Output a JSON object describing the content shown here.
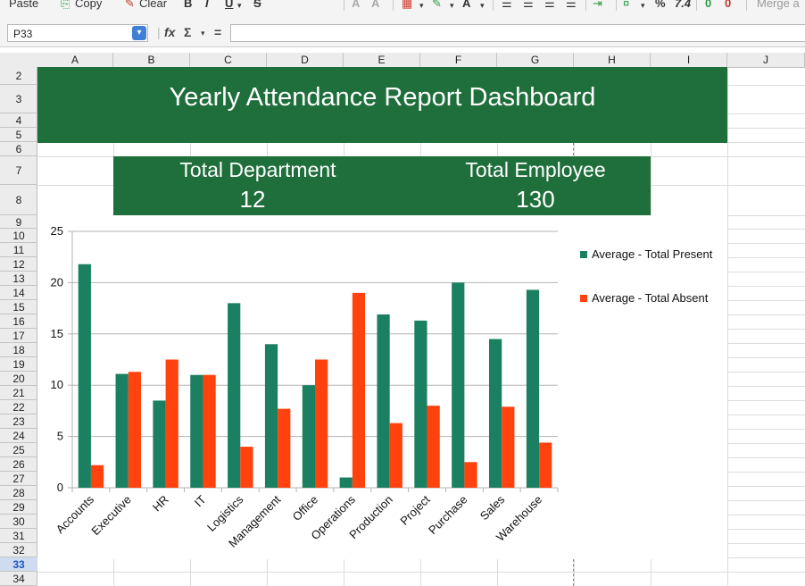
{
  "toolbar": {
    "paste": "Paste",
    "copy": "Copy",
    "clear": "Clear",
    "bold": "B",
    "italic": "I",
    "underline": "U",
    "strike": "S",
    "percent": "%",
    "decimal": "7.4",
    "merge": "Merge a"
  },
  "formula_bar": {
    "cell_ref": "P33",
    "fx": "fx",
    "sigma": "Σ",
    "equals": "=",
    "formula": ""
  },
  "columns": [
    "A",
    "B",
    "C",
    "D",
    "E",
    "F",
    "G",
    "H",
    "I",
    "J"
  ],
  "rows": [
    "2",
    "3",
    "4",
    "5",
    "6",
    "7",
    "8",
    "9",
    "10",
    "11",
    "12",
    "13",
    "14",
    "15",
    "16",
    "17",
    "18",
    "19",
    "20",
    "21",
    "22",
    "23",
    "24",
    "25",
    "26",
    "27",
    "28",
    "29",
    "30",
    "31",
    "32",
    "33",
    "34"
  ],
  "selected_row": "33",
  "dashboard": {
    "title": "Yearly Attendance Report Dashboard",
    "kpi_department_label": "Total Department",
    "kpi_department_value": "12",
    "kpi_employee_label": "Total Employee",
    "kpi_employee_value": "130"
  },
  "chart_data": {
    "type": "bar",
    "title": "",
    "xlabel": "",
    "ylabel": "",
    "ylim": [
      0,
      25
    ],
    "yticks": [
      0,
      5,
      10,
      15,
      20,
      25
    ],
    "grid": true,
    "legend_position": "right",
    "categories": [
      "Accounts",
      "Executive",
      "HR",
      "IT",
      "Logistics",
      "Management",
      "Office",
      "Operations",
      "Production",
      "Project",
      "Purchase",
      "Sales",
      "Warehouse"
    ],
    "series": [
      {
        "name": "Average - Total Present",
        "color": "#1b8061",
        "values": [
          21.8,
          11.1,
          8.5,
          11.0,
          18.0,
          14.0,
          10.0,
          1.0,
          16.9,
          16.3,
          20.0,
          14.5,
          19.3
        ]
      },
      {
        "name": "Average - Total Absent",
        "color": "#ff420e",
        "values": [
          2.2,
          11.3,
          12.5,
          11.0,
          4.0,
          7.7,
          12.5,
          19.0,
          6.3,
          8.0,
          2.5,
          7.9,
          4.4
        ]
      }
    ]
  }
}
